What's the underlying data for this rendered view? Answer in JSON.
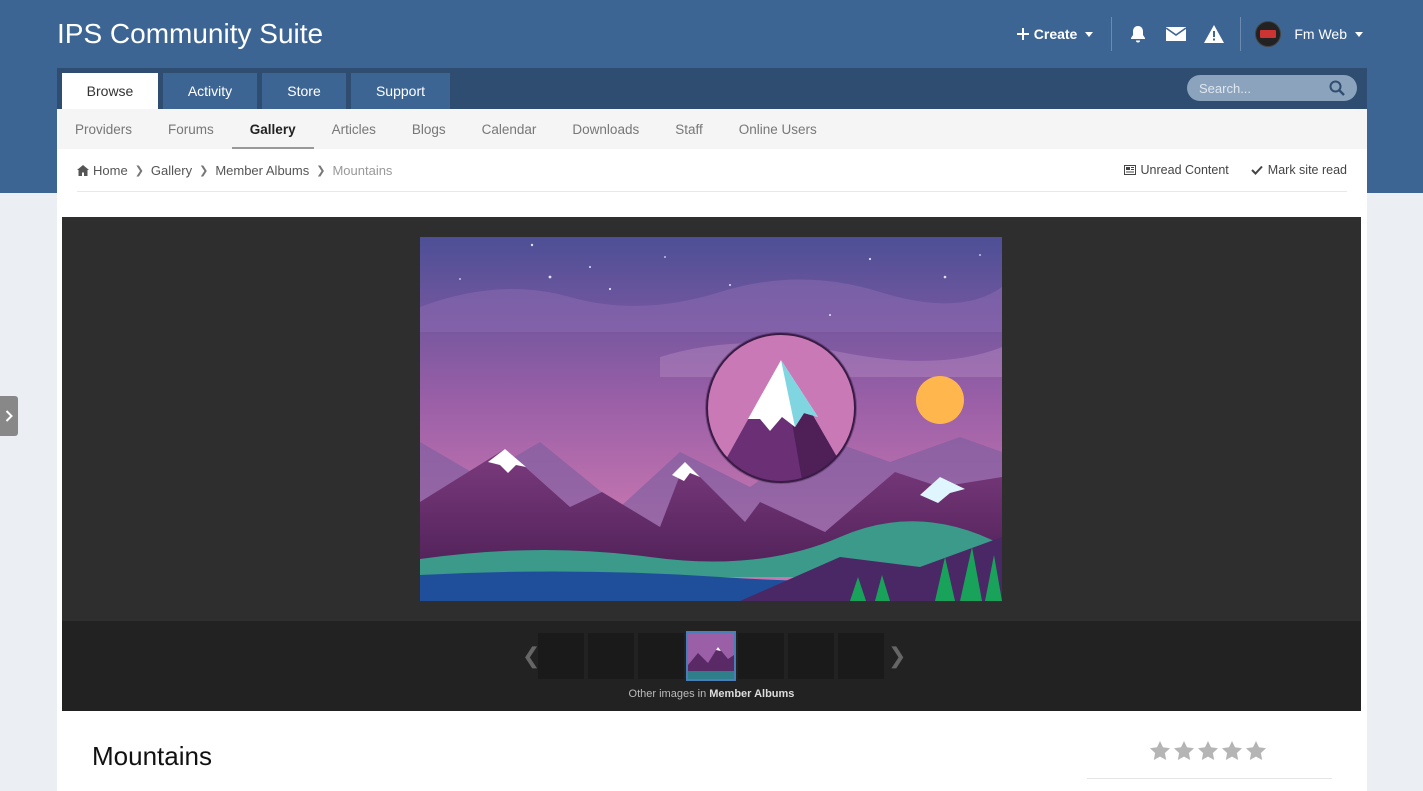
{
  "site": {
    "title": "IPS Community Suite"
  },
  "user_bar": {
    "create_label": "Create",
    "username": "Fm Web"
  },
  "nav": {
    "tabs": [
      {
        "label": "Browse",
        "active": true
      },
      {
        "label": "Activity",
        "active": false
      },
      {
        "label": "Store",
        "active": false
      },
      {
        "label": "Support",
        "active": false
      }
    ],
    "search_placeholder": "Search...",
    "subnav": [
      {
        "label": "Providers"
      },
      {
        "label": "Forums"
      },
      {
        "label": "Gallery",
        "active": true
      },
      {
        "label": "Articles"
      },
      {
        "label": "Blogs"
      },
      {
        "label": "Calendar"
      },
      {
        "label": "Downloads"
      },
      {
        "label": "Staff"
      },
      {
        "label": "Online Users"
      }
    ]
  },
  "breadcrumb": {
    "items": [
      "Home",
      "Gallery",
      "Member Albums",
      "Mountains"
    ],
    "unread_label": "Unread Content",
    "mark_read_label": "Mark site read"
  },
  "gallery": {
    "caption_prefix": "Other images in",
    "caption_album": "Member Albums"
  },
  "image": {
    "title": "Mountains"
  },
  "colors": {
    "header": "#3d6594",
    "tabbar": "#2e4d70",
    "accent": "#4a7eb8"
  }
}
